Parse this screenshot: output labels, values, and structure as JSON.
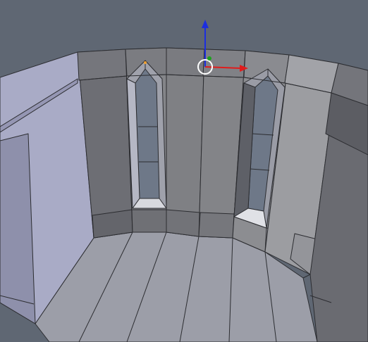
{
  "viewport": {
    "background": "#5f6773",
    "edge_color": "#2c2d31"
  },
  "gizmo": {
    "x_axis_color": "#e01c1c",
    "y_axis_color": "#1da21d",
    "z_axis_color": "#1c2ee0",
    "cursor_color": "#ffffff",
    "origin_color": "#f0a030"
  },
  "icons": [
    "3d-cursor-icon",
    "transform-gizmo-icon"
  ]
}
